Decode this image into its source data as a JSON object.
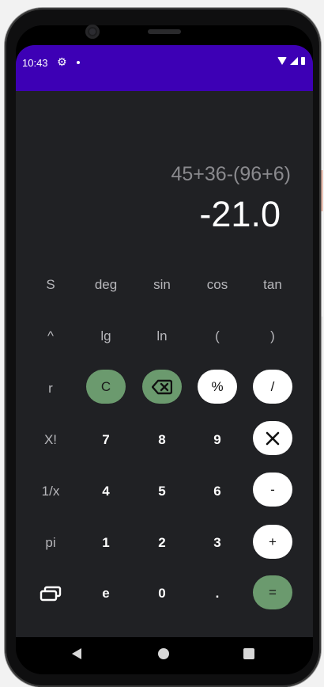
{
  "status_bar": {
    "time": "10:43",
    "icons": [
      "settings-icon",
      "notification-dot",
      "wifi-icon",
      "signal-icon",
      "battery-icon"
    ]
  },
  "display": {
    "expression": "45+36-(96+6)",
    "result": "-21.0"
  },
  "keys": {
    "r1": [
      "S",
      "deg",
      "sin",
      "cos",
      "tan"
    ],
    "r2": [
      "^",
      "lg",
      "ln",
      "(",
      ")"
    ],
    "r3": [
      "r",
      "C",
      "backspace",
      "%",
      "/"
    ],
    "r4": [
      "X!",
      "7",
      "8",
      "9",
      "×"
    ],
    "r5": [
      "1/x",
      "4",
      "5",
      "6",
      "-"
    ],
    "r6": [
      "pi",
      "1",
      "2",
      "3",
      "+"
    ],
    "r7": [
      "history",
      "e",
      "0",
      ".",
      "="
    ]
  },
  "colors": {
    "status_bar": "#3d00b5",
    "screen_bg": "#202124",
    "accent_green": "#6b9a6e",
    "op_white": "#ffffff"
  }
}
